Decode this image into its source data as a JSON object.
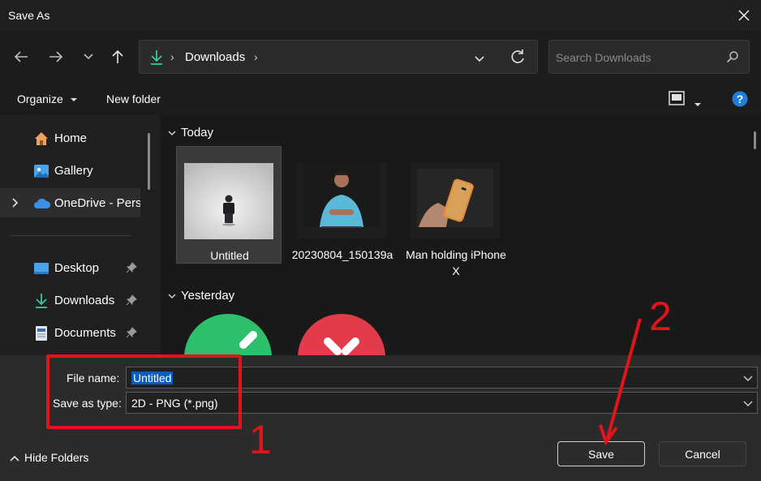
{
  "window": {
    "title": "Save As"
  },
  "address": {
    "location": "Downloads"
  },
  "search": {
    "placeholder": "Search Downloads"
  },
  "commandbar": {
    "organize": "Organize",
    "new_folder": "New folder"
  },
  "sidebar": {
    "items": [
      {
        "label": "Home"
      },
      {
        "label": "Gallery"
      },
      {
        "label": "OneDrive - Perso"
      },
      {
        "label": "Desktop"
      },
      {
        "label": "Downloads"
      },
      {
        "label": "Documents"
      }
    ]
  },
  "content": {
    "groups": [
      {
        "label": "Today"
      },
      {
        "label": "Yesterday"
      }
    ],
    "files": [
      {
        "name": "Untitled"
      },
      {
        "name": "20230804_150139a"
      },
      {
        "name": "Man holding iPhone X"
      }
    ]
  },
  "footer": {
    "file_name_label": "File name:",
    "file_name_value": "Untitled",
    "save_type_label": "Save as type:",
    "save_type_value": "2D - PNG (*.png)",
    "save": "Save",
    "cancel": "Cancel",
    "hide_folders": "Hide Folders"
  },
  "annotations": {
    "step1": "1",
    "step2": "2",
    "color": "#e0141b"
  },
  "colors": {
    "accent": "#0a5cc2",
    "window_bg": "#202020",
    "footer_bg": "#2b2b2b"
  }
}
